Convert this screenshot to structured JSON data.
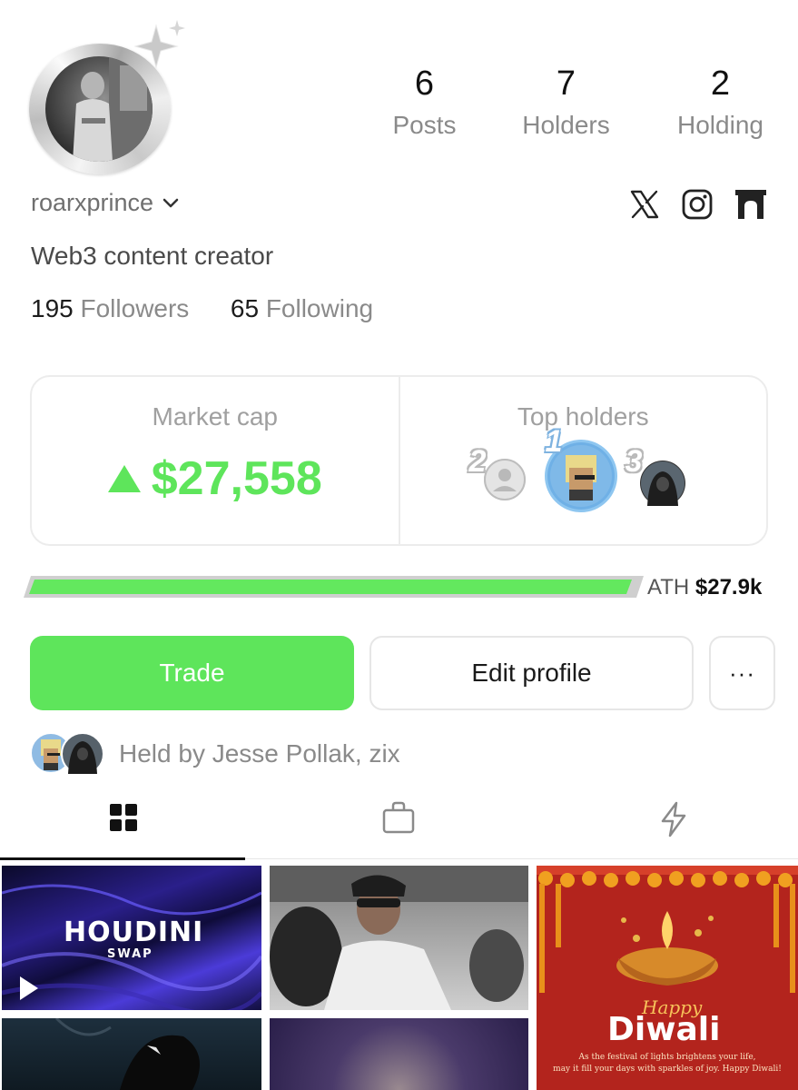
{
  "profile": {
    "username": "roarxprince",
    "bio": "Web3 content creator",
    "followers_count": "195",
    "followers_label": "Followers",
    "following_count": "65",
    "following_label": "Following"
  },
  "stats": [
    {
      "value": "6",
      "label": "Posts"
    },
    {
      "value": "7",
      "label": "Holders"
    },
    {
      "value": "2",
      "label": "Holding"
    }
  ],
  "socials": [
    "x-icon",
    "instagram-icon",
    "gate-icon"
  ],
  "market": {
    "title": "Market cap",
    "value": "$27,558",
    "trend": "up",
    "accent_color": "#5ee55b"
  },
  "top_holders": {
    "title": "Top holders",
    "ranks": [
      "2",
      "1",
      "3"
    ]
  },
  "ath": {
    "label": "ATH",
    "value": "$27.9k",
    "progress_fraction": 0.99
  },
  "actions": {
    "trade_label": "Trade",
    "edit_label": "Edit profile",
    "more_label": "···"
  },
  "held_by": {
    "text": "Held by Jesse Pollak, zix"
  },
  "tabs": [
    {
      "name": "grid-icon",
      "active": true
    },
    {
      "name": "bag-icon",
      "active": false
    },
    {
      "name": "lightning-icon",
      "active": false
    }
  ],
  "posts": {
    "houdini_title": "HOUDINI",
    "houdini_sub": "SWAP",
    "diwali_happy": "Happy",
    "diwali_title": "Diwali",
    "diwali_line1": "As the festival of lights brightens your life,",
    "diwali_line2": "may it fill your days with sparkles of joy. Happy Diwali!"
  }
}
